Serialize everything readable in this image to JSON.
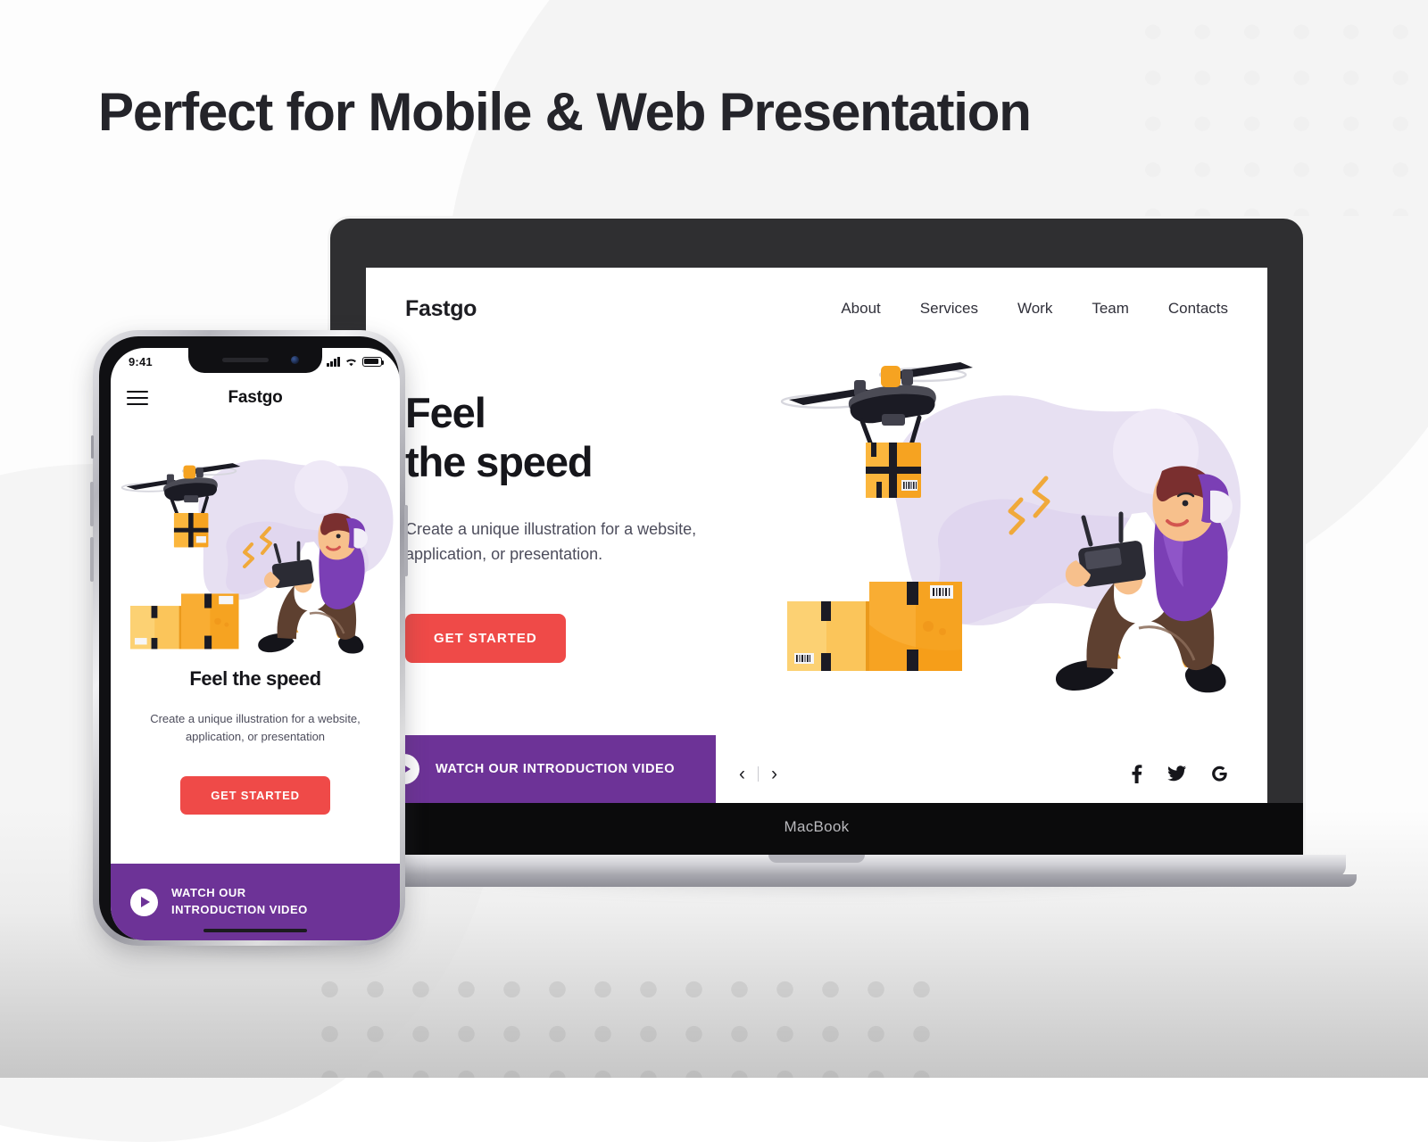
{
  "poster": {
    "headline": "Perfect for Mobile & Web Presentation"
  },
  "colors": {
    "accent_red": "#ef4a48",
    "accent_purple": "#6d3397",
    "ink": "#16161b",
    "muted_text": "#4d4d5c",
    "bezel_dark": "#2f2f31",
    "page_bg": "#ffffff",
    "box_orange": "#f6a321",
    "box_orange_light": "#fbc55a",
    "blob_purple": "#e7e0f2"
  },
  "laptop": {
    "device_label": "MacBook",
    "site": {
      "logo": "Fastgo",
      "nav": [
        {
          "label": "About"
        },
        {
          "label": "Services"
        },
        {
          "label": "Work"
        },
        {
          "label": "Team"
        },
        {
          "label": "Contacts"
        }
      ],
      "hero": {
        "title_line1": "Feel",
        "title_line2": "the speed",
        "subtitle": "Create a unique illustration for a website, application, or presentation.",
        "cta_label": "GET STARTED"
      },
      "videobar": {
        "label": "WATCH OUR INTRODUCTION VIDEO",
        "play_icon": "play-icon"
      },
      "carousel": {
        "prev_icon": "chevron-left-icon",
        "prev_glyph": "‹",
        "next_icon": "chevron-right-icon",
        "next_glyph": "›"
      },
      "social": [
        {
          "name": "facebook-icon"
        },
        {
          "name": "twitter-icon"
        },
        {
          "name": "google-icon"
        }
      ]
    }
  },
  "phone": {
    "status": {
      "time": "9:41",
      "signal_icon": "cellular-signal-icon",
      "wifi_icon": "wifi-icon",
      "battery_icon": "battery-icon"
    },
    "nav": {
      "menu_icon": "hamburger-menu-icon",
      "title": "Fastgo"
    },
    "hero": {
      "title": "Feel the speed",
      "subtitle": "Create a unique illustration for a website, application, or presentation",
      "cta_label": "GET STARTED"
    },
    "videobar": {
      "line1": "WATCH OUR",
      "line2": "INTRODUCTION VIDEO",
      "play_icon": "play-icon"
    }
  }
}
